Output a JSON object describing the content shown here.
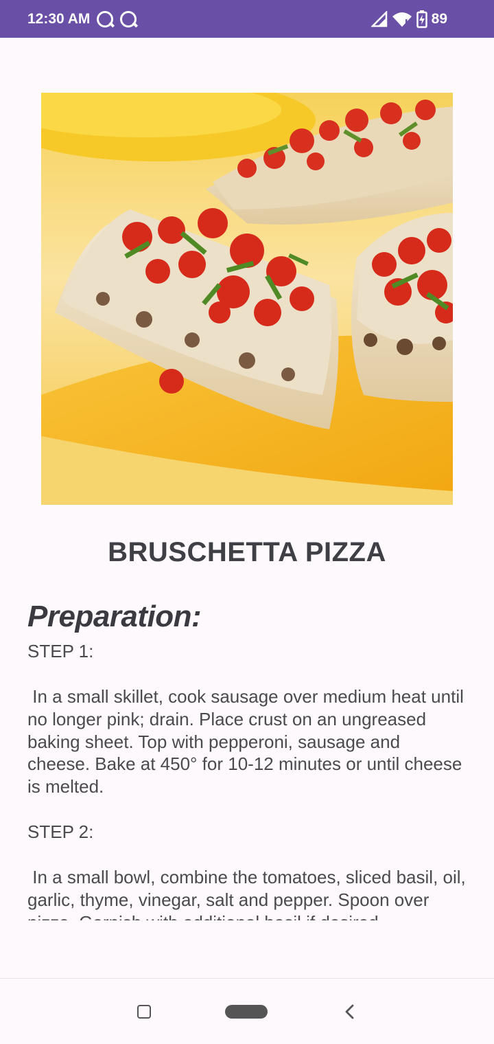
{
  "status_bar": {
    "time": "12:30 AM",
    "battery": "89",
    "background_color": "#6a4fa6",
    "icons": [
      "q-icon",
      "q-icon",
      "signal-icon",
      "wifi-icon",
      "battery-charging-icon"
    ]
  },
  "recipe": {
    "title": "BRUSCHETTA PIZZA",
    "image": "bruschetta-pizza-photo",
    "preparation_heading": "Preparation:",
    "step1_label": "STEP 1:",
    "step1_text": " In a small skillet, cook sausage over medium heat until no longer pink; drain. Place crust on an ungreased baking sheet. Top with pepperoni, sausage and cheese. Bake at 450° for 10-12 minutes or until cheese is melted.",
    "step2_label": "STEP 2:",
    "step2_text": " In a small bowl, combine the tomatoes, sliced basil, oil, garlic, thyme, vinegar, salt and pepper. Spoon over pizza. Garnish with additional basil if desired."
  },
  "nav_bar": {
    "icons": [
      "recents-icon",
      "home-pill-icon",
      "back-icon"
    ]
  }
}
